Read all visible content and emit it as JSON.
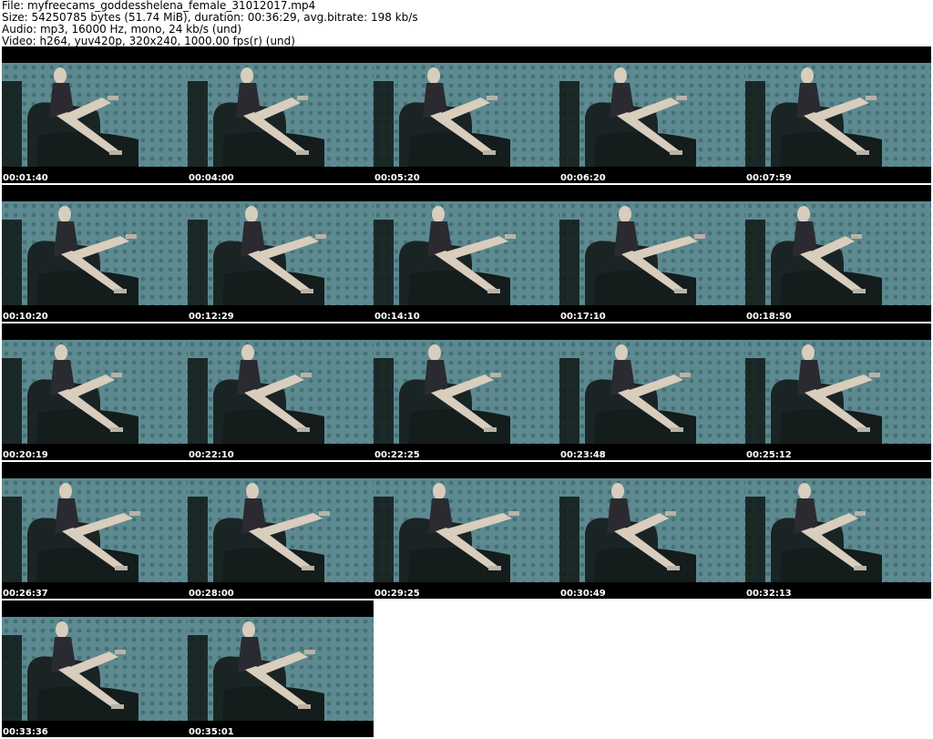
{
  "header": {
    "file": "File: myfreecams_goddesshelena_female_31012017.mp4",
    "size": "Size: 54250785 bytes (51.74 MiB), duration: 00:36:29, avg.bitrate: 198 kb/s",
    "audio": "Audio: mp3, 16000 Hz, mono, 24 kb/s (und)",
    "video": "Video: h264, yuv420p, 320x240, 1000.00 fps(r) (und)"
  },
  "thumbnails": [
    {
      "time": "00:01:40"
    },
    {
      "time": "00:04:00"
    },
    {
      "time": "00:05:20"
    },
    {
      "time": "00:06:20"
    },
    {
      "time": "00:07:59"
    },
    {
      "time": "00:10:20"
    },
    {
      "time": "00:12:29"
    },
    {
      "time": "00:14:10"
    },
    {
      "time": "00:17:10"
    },
    {
      "time": "00:18:50"
    },
    {
      "time": "00:20:19"
    },
    {
      "time": "00:22:10"
    },
    {
      "time": "00:22:25"
    },
    {
      "time": "00:23:48"
    },
    {
      "time": "00:25:12"
    },
    {
      "time": "00:26:37"
    },
    {
      "time": "00:28:00"
    },
    {
      "time": "00:29:25"
    },
    {
      "time": "00:30:49"
    },
    {
      "time": "00:32:13"
    },
    {
      "time": "00:33:36"
    },
    {
      "time": "00:35:01"
    }
  ],
  "colors": {
    "wallpaper": "#5d8a90",
    "wallpaper_dark": "#3c6568",
    "chair": "#1b2424",
    "skin": "#d9cdbd",
    "dress": "#2a2a30",
    "bar": "#000000"
  }
}
